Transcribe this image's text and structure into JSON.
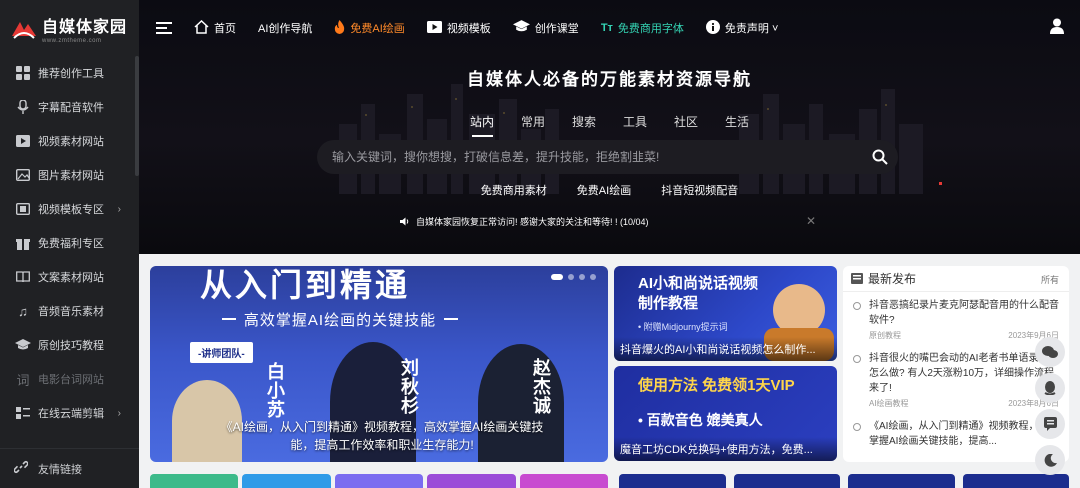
{
  "logo": {
    "title": "自媒体家园",
    "subtitle": "www.zmtheme.com"
  },
  "sidebar": {
    "items": [
      {
        "label": "推荐创作工具",
        "icon": "grid-icon"
      },
      {
        "label": "字幕配音软件",
        "icon": "microphone-icon"
      },
      {
        "label": "视频素材网站",
        "icon": "video-play-icon"
      },
      {
        "label": "图片素材网站",
        "icon": "image-icon"
      },
      {
        "label": "视频模板专区",
        "icon": "film-icon",
        "arrow": "›"
      },
      {
        "label": "免费福利专区",
        "icon": "gift-icon"
      },
      {
        "label": "文案素材网站",
        "icon": "book-icon"
      },
      {
        "label": "音频音乐素材",
        "icon": "music-note-icon"
      },
      {
        "label": "原创技巧教程",
        "icon": "graduation-cap-icon"
      },
      {
        "label": "电影台词网站",
        "icon": "text-word-icon"
      },
      {
        "label": "在线云端剪辑",
        "icon": "layout-icon",
        "arrow": "›"
      }
    ],
    "footer": {
      "label": "友情链接",
      "icon": "link-icon"
    }
  },
  "topnav": {
    "items": [
      {
        "label": "首页",
        "icon": "home-icon",
        "style": "normal"
      },
      {
        "label": "AI创作导航",
        "icon": "",
        "style": "normal"
      },
      {
        "label": "免费AI绘画",
        "icon": "fire-icon",
        "style": "fire"
      },
      {
        "label": "视频模板",
        "icon": "video-play-icon",
        "style": "normal"
      },
      {
        "label": "创作课堂",
        "icon": "graduation-cap-icon",
        "style": "normal"
      },
      {
        "label": "免费商用字体",
        "icon": "font-icon",
        "style": "teal"
      },
      {
        "label": "免责声明 ˅",
        "icon": "info-icon",
        "style": "normal"
      }
    ]
  },
  "hero": {
    "title": "自媒体人必备的万能素材资源导航",
    "tabs": [
      "站内",
      "常用",
      "搜索",
      "工具",
      "社区",
      "生活"
    ],
    "search_placeholder": "输入关键词，搜你想搜，打破信息差，提升技能，拒绝割韭菜!",
    "quick_links": [
      "免费商用素材",
      "免费AI绘画",
      "抖音短视频配音"
    ],
    "notice": "自媒体家园恢复正常访问! 感谢大家的关注和等待! ! (10/04)"
  },
  "big_card": {
    "headline": "从入门到精通",
    "subline": "高效掌握AI绘画的关键技能",
    "team_tag": "-讲师团队-",
    "names": [
      "白小苏",
      "刘秋杉",
      "赵杰诚"
    ],
    "caption": "《AI绘画，从入门到精通》视频教程，高效掌握AI绘画关键技能，提高工作效率和职业生存能力!"
  },
  "mid_cards": [
    {
      "headline": "AI小和尚说话视频制作教程",
      "note": "• 附赠Midjourny提示词",
      "caption": "抖音爆火的AI小和尚说话视频怎么制作..."
    },
    {
      "headline": "使用方法 免费领1天VIP",
      "note": "• 百款音色 媲美真人",
      "caption": "魔音工坊CDK兑换码+使用方法，免费..."
    }
  ],
  "news": {
    "title": "最新发布",
    "all_label": "所有",
    "items": [
      {
        "text": "抖音恶搞纪录片麦克阿瑟配音用的什么配音软件?",
        "category": "原创教程",
        "date": "2023年9月6日"
      },
      {
        "text": "抖音很火的嘴巴会动的AI老者书单语录视频怎么做? 有人2天涨粉10万，详细操作流程来了!",
        "category": "AI绘画教程",
        "date": "2023年8月6日"
      },
      {
        "text": "《AI绘画，从入门到精通》视频教程，高效掌握AI绘画关键技能，提高...",
        "category": "",
        "date": ""
      }
    ]
  },
  "float_tools": [
    "wechat-icon",
    "qq-icon",
    "comment-icon",
    "moon-icon"
  ],
  "colors": {
    "sidebar_bg": "#202124",
    "accent_fire": "#ff8a2a",
    "accent_teal": "#34d3b3",
    "card_blue": "#2d48c9"
  }
}
